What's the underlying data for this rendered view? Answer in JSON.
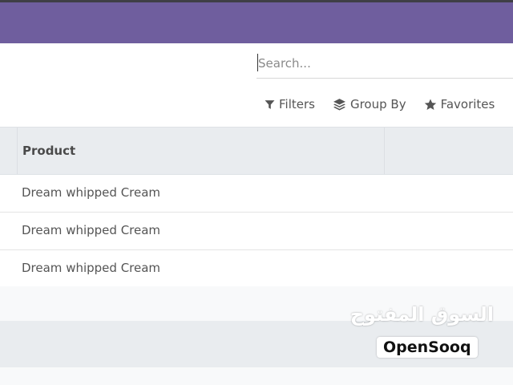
{
  "search": {
    "placeholder": "Search..."
  },
  "search_options": {
    "filters": {
      "label": "Filters",
      "icon": "filter-icon"
    },
    "group_by": {
      "label": "Group By",
      "icon": "layers-icon"
    },
    "favorites": {
      "label": "Favorites",
      "icon": "star-icon"
    }
  },
  "table": {
    "columns": [
      "Product"
    ],
    "rows": [
      {
        "product": "Dream whipped Cream"
      },
      {
        "product": "Dream whipped Cream"
      },
      {
        "product": "Dream whipped Cream"
      }
    ]
  },
  "watermark": {
    "arabic": "السوق المفتوح",
    "latin": "OpenSooq"
  },
  "colors": {
    "navbar": "#6f5e9e",
    "header_bg": "#e9ecef"
  }
}
